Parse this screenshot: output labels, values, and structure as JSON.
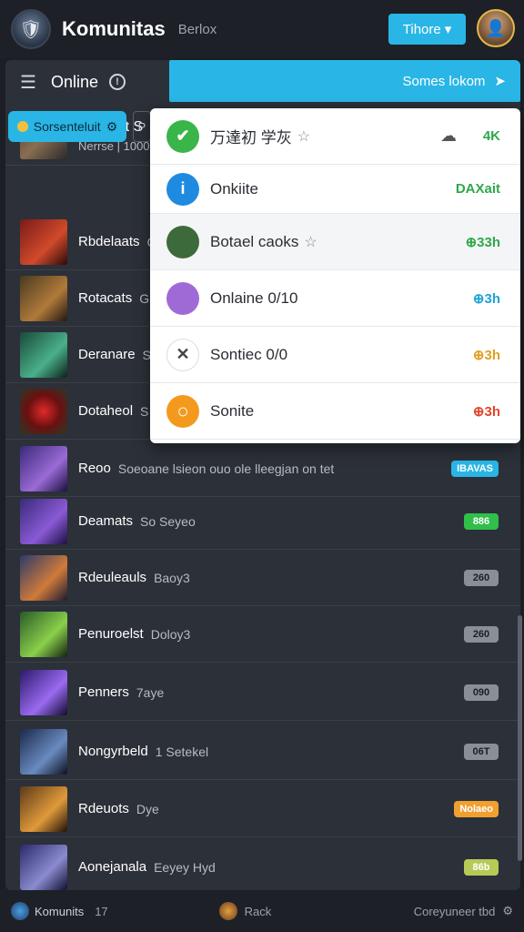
{
  "app": {
    "title": "Komunitas",
    "subtitle": "Berlox",
    "top_button": "Tihore",
    "top_button_icon": "▾"
  },
  "panel": {
    "title": "Online",
    "search_label": "Somes lokom"
  },
  "first_row": {
    "title": "Notiuurt S",
    "subtitle": "Nerrse | 1000"
  },
  "filter": {
    "chip_label": "Sorsenteluit",
    "chip2_label": "P"
  },
  "dropdown": [
    {
      "label": "万達初 学灰",
      "value": "4K",
      "icon": "check-circle-icon",
      "color": "#3ab54a",
      "value_color": "#2ea84a",
      "star": true,
      "cloud": true
    },
    {
      "label": "Onkiite",
      "value": "DAXait",
      "icon": "info-circle-icon",
      "color": "#1f8be0",
      "value_color": "#2ea84a"
    },
    {
      "label": "Botael caoks",
      "value": "⊕33h",
      "icon": "avatar",
      "color": "#3d6a3a",
      "value_color": "#2ea84a",
      "star": true
    },
    {
      "label": "Onlaine 0/10",
      "value": "⊕3h",
      "icon": "avatar",
      "color": "#a06ad6",
      "value_color": "#1fa3d6"
    },
    {
      "label": "Sontiec 0/0",
      "value": "⊕3h",
      "icon": "sword-icon",
      "color": "#ffffff",
      "value_color": "#e0a020"
    },
    {
      "label": "Sonite",
      "value": "⊕3h",
      "icon": "ring-icon",
      "color": "#f39a1e",
      "value_color": "#e0462a"
    }
  ],
  "rows": [
    {
      "title": "Rbdelaats",
      "sub": "G",
      "badge": "",
      "badge_color": ""
    },
    {
      "title": "Rotacats",
      "sub": "G",
      "badge": "",
      "badge_color": ""
    },
    {
      "title": "Deranare",
      "sub": "S",
      "badge": "",
      "badge_color": ""
    },
    {
      "title": "Dotaheol",
      "sub": "S",
      "badge": "",
      "badge_color": ""
    },
    {
      "title": "Reoo",
      "sub": "Soeoane lsieon ouo ole lleegjan on tet",
      "badge": "IBAVAS",
      "badge_color": "#29b6e6"
    },
    {
      "title": "Deamats",
      "sub": "So Seyeo",
      "badge": "886",
      "badge_color": "#2fbf4a"
    },
    {
      "title": "Rdeuleauls",
      "sub": "Baoy3",
      "badge": "260",
      "badge_color": "#8a8f97"
    },
    {
      "title": "Penuroelst",
      "sub": "Doloy3",
      "badge": "260",
      "badge_color": "#8a8f97"
    },
    {
      "title": "Penners",
      "sub": "7aye",
      "badge": "090",
      "badge_color": "#8a8f97"
    },
    {
      "title": "Nongyrbeld",
      "sub": "1 Setekel",
      "badge": "06T",
      "badge_color": "#8a8f97"
    },
    {
      "title": "Rdeuots",
      "sub": "Dye",
      "badge": "Nolaeo",
      "badge_color": "#f0a030"
    },
    {
      "title": "Aonejanala",
      "sub": "Eeyey Hyd",
      "badge": "86b",
      "badge_color": "#b7c957"
    }
  ],
  "bottom": {
    "left_label": "Komunits",
    "left_count": "17",
    "mid_label": "Rack",
    "right_label": "Coreyuneer tbd"
  }
}
